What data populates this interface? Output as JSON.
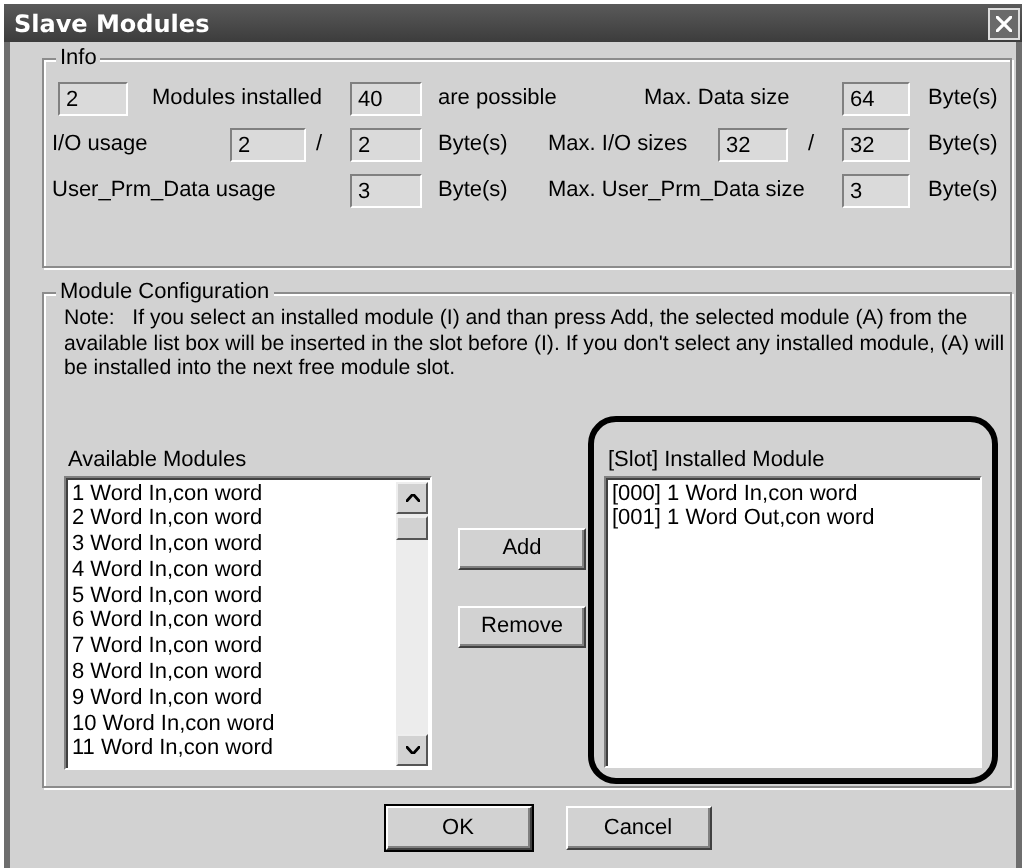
{
  "window": {
    "title": "Slave Modules"
  },
  "info": {
    "legend": "Info",
    "rows": [
      {
        "items": [
          {
            "kind": "field",
            "text": "2"
          },
          {
            "kind": "label",
            "text": "Modules installed"
          },
          {
            "kind": "field",
            "text": "40"
          },
          {
            "kind": "label",
            "text": "are possible"
          },
          {
            "kind": "label",
            "text": "Max. Data size"
          },
          {
            "kind": "field",
            "text": "64"
          },
          {
            "kind": "label",
            "text": "Byte(s)"
          }
        ]
      },
      {
        "items": [
          {
            "kind": "label",
            "text": "I/O usage"
          },
          {
            "kind": "field",
            "text": "2"
          },
          {
            "kind": "label",
            "text": "/"
          },
          {
            "kind": "field",
            "text": "2"
          },
          {
            "kind": "label",
            "text": "Byte(s)"
          },
          {
            "kind": "label",
            "text": "Max. I/O sizes"
          },
          {
            "kind": "field",
            "text": "32"
          },
          {
            "kind": "label",
            "text": "/"
          },
          {
            "kind": "field",
            "text": "32"
          },
          {
            "kind": "label",
            "text": "Byte(s)"
          }
        ]
      },
      {
        "items": [
          {
            "kind": "label",
            "text": "User_Prm_Data usage"
          },
          {
            "kind": "field",
            "text": "3"
          },
          {
            "kind": "label",
            "text": "Byte(s)"
          },
          {
            "kind": "label",
            "text": "Max. User_Prm_Data size"
          },
          {
            "kind": "field",
            "text": "3"
          },
          {
            "kind": "label",
            "text": "Byte(s)"
          }
        ]
      }
    ]
  },
  "module_configuration": {
    "legend": "Module Configuration",
    "note": "Note:   If you select an installed module (I) and than press Add, the selected module (A) from the available list box will be inserted in the slot before (I). If you don't select any installed module, (A) will be installed into the next free module slot.",
    "available": {
      "label": "Available Modules",
      "items": [
        "1 Word In,con word",
        "2 Word In,con word",
        "3 Word In,con word",
        "4 Word In,con word",
        "5 Word In,con word",
        "6 Word In,con word",
        "7 Word In,con word",
        "8 Word In,con word",
        "9 Word In,con word",
        "10 Word In,con word",
        "11 Word In,con word"
      ]
    },
    "actions": [
      {
        "label": "Add"
      },
      {
        "label": "Remove"
      }
    ],
    "installed": {
      "label": "[Slot] Installed Module",
      "items": [
        "[000] 1 Word In,con word",
        "[001] 1 Word Out,con word"
      ]
    }
  },
  "buttons": [
    {
      "label": "OK",
      "default": true
    },
    {
      "label": "Cancel",
      "default": false
    }
  ]
}
